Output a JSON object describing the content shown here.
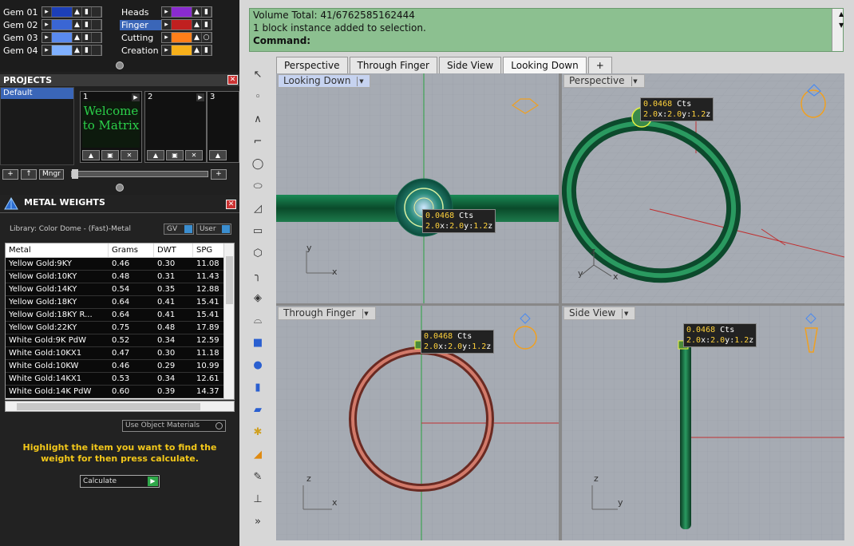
{
  "layers": {
    "left": [
      {
        "name": "Gem 01",
        "color": "#1c3fb8"
      },
      {
        "name": "Gem 02",
        "color": "#3a66d4"
      },
      {
        "name": "Gem 03",
        "color": "#5a8aee"
      },
      {
        "name": "Gem 04",
        "color": "#7fb0ff"
      }
    ],
    "right": [
      {
        "name": "Heads",
        "color": "#8a2bd0"
      },
      {
        "name": "Finger",
        "color": "#c02020",
        "selected": true
      },
      {
        "name": "Cutting",
        "color": "#ff7f1a"
      },
      {
        "name": "Creation",
        "color": "#f7b01a"
      }
    ]
  },
  "projects": {
    "title": "PROJECTS",
    "list": [
      "Default"
    ],
    "slots": [
      {
        "num": "1",
        "thumb": "Welcome to Matrix"
      },
      {
        "num": "2",
        "thumb": ""
      },
      {
        "num": "3",
        "thumb": ""
      }
    ],
    "mngr_label": "Mngr"
  },
  "metal_weights": {
    "title": "METAL WEIGHTS",
    "library": "Library: Color Dome - (Fast)-Metal",
    "gv_label": "GV",
    "user_label": "User",
    "columns": [
      "Metal",
      "Grams",
      "DWT",
      "SPG"
    ],
    "rows": [
      [
        "Yellow Gold:9KY",
        "0.46",
        "0.30",
        "11.08"
      ],
      [
        "Yellow Gold:10KY",
        "0.48",
        "0.31",
        "11.43"
      ],
      [
        "Yellow Gold:14KY",
        "0.54",
        "0.35",
        "12.88"
      ],
      [
        "Yellow Gold:18KY",
        "0.64",
        "0.41",
        "15.41"
      ],
      [
        "Yellow Gold:18KY R...",
        "0.64",
        "0.41",
        "15.41"
      ],
      [
        "Yellow Gold:22KY",
        "0.75",
        "0.48",
        "17.89"
      ],
      [
        "White Gold:9K PdW",
        "0.52",
        "0.34",
        "12.59"
      ],
      [
        "White Gold:10KX1",
        "0.47",
        "0.30",
        "11.18"
      ],
      [
        "White Gold:10KW",
        "0.46",
        "0.29",
        "10.99"
      ],
      [
        "White Gold:14KX1",
        "0.53",
        "0.34",
        "12.61"
      ],
      [
        "White Gold:14K PdW",
        "0.60",
        "0.39",
        "14.37"
      ]
    ],
    "use_object_materials": "Use Object Materials",
    "hint": "Highlight the item you want to find the weight for then press calculate.",
    "calculate_label": "Calculate"
  },
  "command": {
    "line1": "Volume Total: 41/6762585162444",
    "line2": "1 block instance added to selection.",
    "prompt": "Command:"
  },
  "tabs": [
    "Perspective",
    "Through Finger",
    "Side View",
    "Looking Down",
    "+"
  ],
  "active_tab": "Looking Down",
  "viewports": {
    "top_left": {
      "label": "Looking Down",
      "axis_a": "y",
      "axis_b": "x"
    },
    "top_right": {
      "label": "Perspective",
      "axis_a": "z",
      "axis_b": "y",
      "axis_c": "x"
    },
    "bottom_left": {
      "label": "Through Finger",
      "axis_a": "z",
      "axis_b": "x"
    },
    "bottom_right": {
      "label": "Side View",
      "axis_a": "z",
      "axis_b": "y"
    }
  },
  "gem_tip": {
    "carats": "0.0468",
    "unit": "Cts",
    "size_x": "2.0",
    "size_y": "2.0",
    "size_z": "1.2"
  },
  "colors": {
    "ring_green": "#0f6a3f",
    "ring_red": "#b7584b",
    "accent_orange": "#f0a020"
  }
}
